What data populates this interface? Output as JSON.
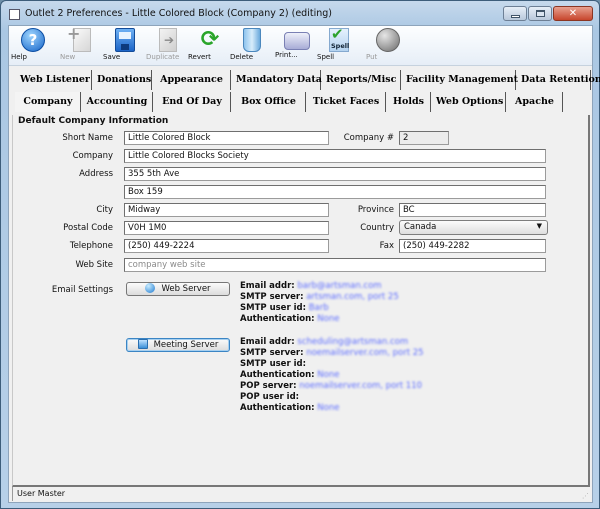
{
  "window": {
    "title": "Outlet 2 Preferences - Little Colored Block (Company 2) (editing)",
    "controls": {
      "minimize": "minimize",
      "maximize": "maximize",
      "close": "✕"
    }
  },
  "toolbar": {
    "buttons": [
      {
        "label": "Help",
        "icon": "help-icon",
        "enabled": true
      },
      {
        "label": "New",
        "icon": "new-document-icon",
        "enabled": false
      },
      {
        "label": "Save",
        "icon": "save-icon",
        "enabled": true
      },
      {
        "label": "Duplicate",
        "icon": "duplicate-icon",
        "enabled": false
      },
      {
        "label": "Revert",
        "icon": "revert-icon",
        "enabled": true
      },
      {
        "label": "Delete",
        "icon": "delete-icon",
        "enabled": true
      },
      {
        "label": "Print...",
        "icon": "print-icon",
        "enabled": true
      },
      {
        "label": "Spell",
        "icon": "spell-check-icon",
        "enabled": true,
        "icon_text": "Spell"
      },
      {
        "label": "Put",
        "icon": "put-globe-icon",
        "enabled": false
      }
    ]
  },
  "tabs": {
    "row1": [
      "Web Listener",
      "Donations",
      "Appearance",
      "Mandatory Data",
      "Reports/Misc",
      "Facility Management",
      "Data Retention"
    ],
    "row2": [
      "Company",
      "Accounting",
      "End Of Day",
      "Box Office",
      "Ticket Faces",
      "Holds",
      "Web Options",
      "Apache"
    ],
    "active": "Company"
  },
  "company": {
    "section_title": "Default Company Information",
    "short_name": {
      "label": "Short Name",
      "value": "Little Colored Block"
    },
    "company_number": {
      "label": "Company #",
      "value": "2"
    },
    "company": {
      "label": "Company",
      "value": "Little Colored Blocks Society"
    },
    "address": {
      "label": "Address",
      "line1": "355 5th Ave",
      "line2": "Box 159"
    },
    "city": {
      "label": "City",
      "value": "Midway"
    },
    "province": {
      "label": "Province",
      "value": "BC"
    },
    "postal_code": {
      "label": "Postal Code",
      "value": "V0H 1M0"
    },
    "country": {
      "label": "Country",
      "value": "Canada"
    },
    "telephone": {
      "label": "Telephone",
      "value": "(250) 449-2224"
    },
    "fax": {
      "label": "Fax",
      "value": "(250) 449-2282"
    },
    "web_site": {
      "label": "Web Site",
      "value": "",
      "placeholder": "company web site"
    }
  },
  "email": {
    "label": "Email Settings",
    "web_server": {
      "button_label": "Web Server",
      "rows": [
        {
          "key": "Email addr:",
          "value": "barb@artsman.com"
        },
        {
          "key": "SMTP server:",
          "value": "artsman.com, port 25"
        },
        {
          "key": "SMTP user id:",
          "value": "Barb"
        },
        {
          "key": "Authentication:",
          "value": "None"
        }
      ]
    },
    "meeting_server": {
      "button_label": "Meeting Server",
      "rows": [
        {
          "key": "Email addr:",
          "value": "scheduling@artsman.com"
        },
        {
          "key": "SMTP server:",
          "value": "noemailserver.com, port 25"
        },
        {
          "key": "SMTP user id:",
          "value": ""
        },
        {
          "key": "Authentication:",
          "value": "None"
        },
        {
          "key": "POP server:",
          "value": "noemailserver.com, port 110"
        },
        {
          "key": "POP user id:",
          "value": ""
        },
        {
          "key": "Authentication:",
          "value": "None"
        }
      ]
    }
  },
  "status": {
    "text": "User Master"
  }
}
